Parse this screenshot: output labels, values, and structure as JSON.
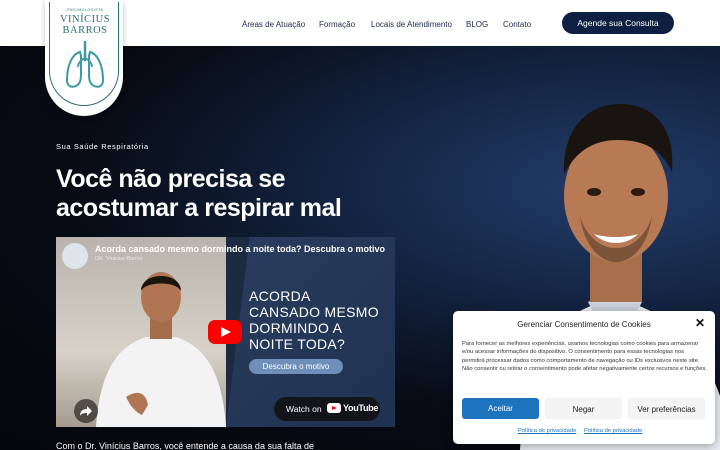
{
  "header": {
    "logo": {
      "subtitle": "PNEUMOLOGISTA",
      "name_line1": "VINÍCIUS",
      "name_line2": "BARROS",
      "icon": "lungs-icon"
    },
    "nav": [
      {
        "label": "Áreas de Atuação"
      },
      {
        "label": "Formação"
      },
      {
        "label": "Locais de Atendimento"
      },
      {
        "label": "BLOG"
      },
      {
        "label": "Contato"
      }
    ],
    "cta_label": "Agende sua Consulta"
  },
  "hero": {
    "eyebrow": "Sua Saúde Respiratória",
    "title_line1": "Você não precisa se",
    "title_line2": "acostumar a respirar mal",
    "body_partial": "Com o Dr. Vinícius Barros, você entende a causa da sua falta de"
  },
  "video": {
    "title": "Acorda cansado mesmo dormindo a noite toda? Descubra o motivo",
    "channel": "DR. Vinicius Barros",
    "overlay_lines": [
      "ACORDA",
      "CANSADO MESMO",
      "DORMINDO A",
      "NOITE TODA?"
    ],
    "overlay_pill": "Descubra o motivo",
    "watch_label": "Watch on",
    "youtube_label": "YouTube",
    "icons": {
      "play": "play-icon",
      "share": "share-icon",
      "youtube": "youtube-logo-icon"
    }
  },
  "consent": {
    "title": "Gerenciar Consentimento de Cookies",
    "body": "Para fornecer as melhores experiências, usamos tecnologias como cookies para armazenar e/ou acessar informações do dispositivo. O consentimento para essas tecnologias nos permitirá processar dados como comportamento de navegação ou IDs exclusivos neste site. Não consentir ou retirar o consentimento pode afetar negativamente certos recursos e funções.",
    "accept_label": "Aceitar",
    "deny_label": "Negar",
    "prefs_label": "Ver preferências",
    "policy_links": [
      "Política de privacidade",
      "Política de privacidade"
    ],
    "close_icon": "close-icon"
  },
  "colors": {
    "brand_navy": "#0e2042",
    "logo_teal": "#2a6f7a",
    "accept_blue": "#1e73be",
    "youtube_red": "#ff0000"
  }
}
